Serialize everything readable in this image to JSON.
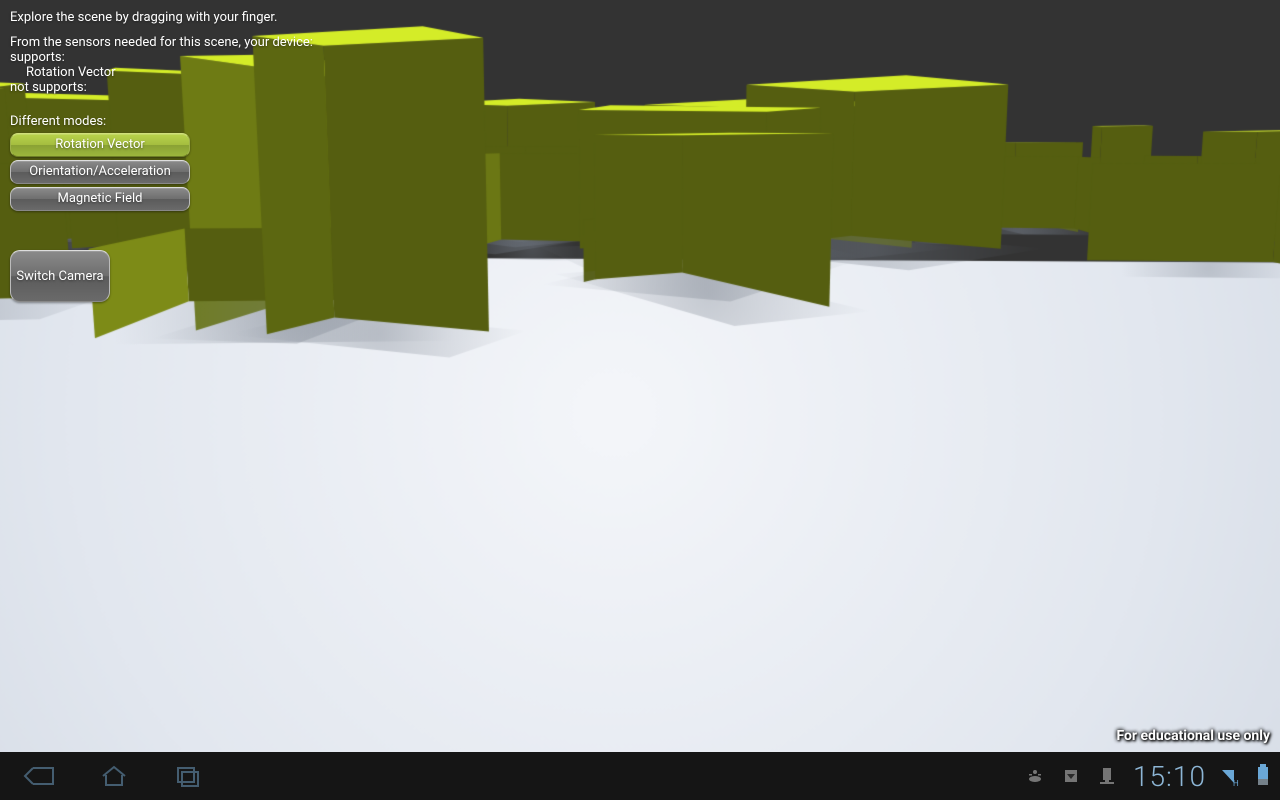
{
  "hud": {
    "instruction": "Explore the scene by dragging with your finger.",
    "sensors_intro": "From the sensors needed for this scene, your device:",
    "supports_label": "supports:",
    "supports_items": [
      "Rotation Vector"
    ],
    "not_supports_label": "not supports:",
    "not_supports_items": [],
    "modes_label": "Different modes:",
    "modes": {
      "rotation_vector": "Rotation Vector",
      "orientation_accel": "Orientation/Acceleration",
      "magnetic_field": "Magnetic Field"
    },
    "switch_camera": "Switch Camera",
    "watermark": "For educational use only"
  },
  "statusbar": {
    "time": "15:10",
    "network_label": "H",
    "icons": [
      "usb-debug-icon",
      "download-icon",
      "apps-icon"
    ]
  },
  "scene": {
    "cube_color": "#aacc22",
    "ground_color": "#e9edf2",
    "sky_color": "#333333"
  }
}
